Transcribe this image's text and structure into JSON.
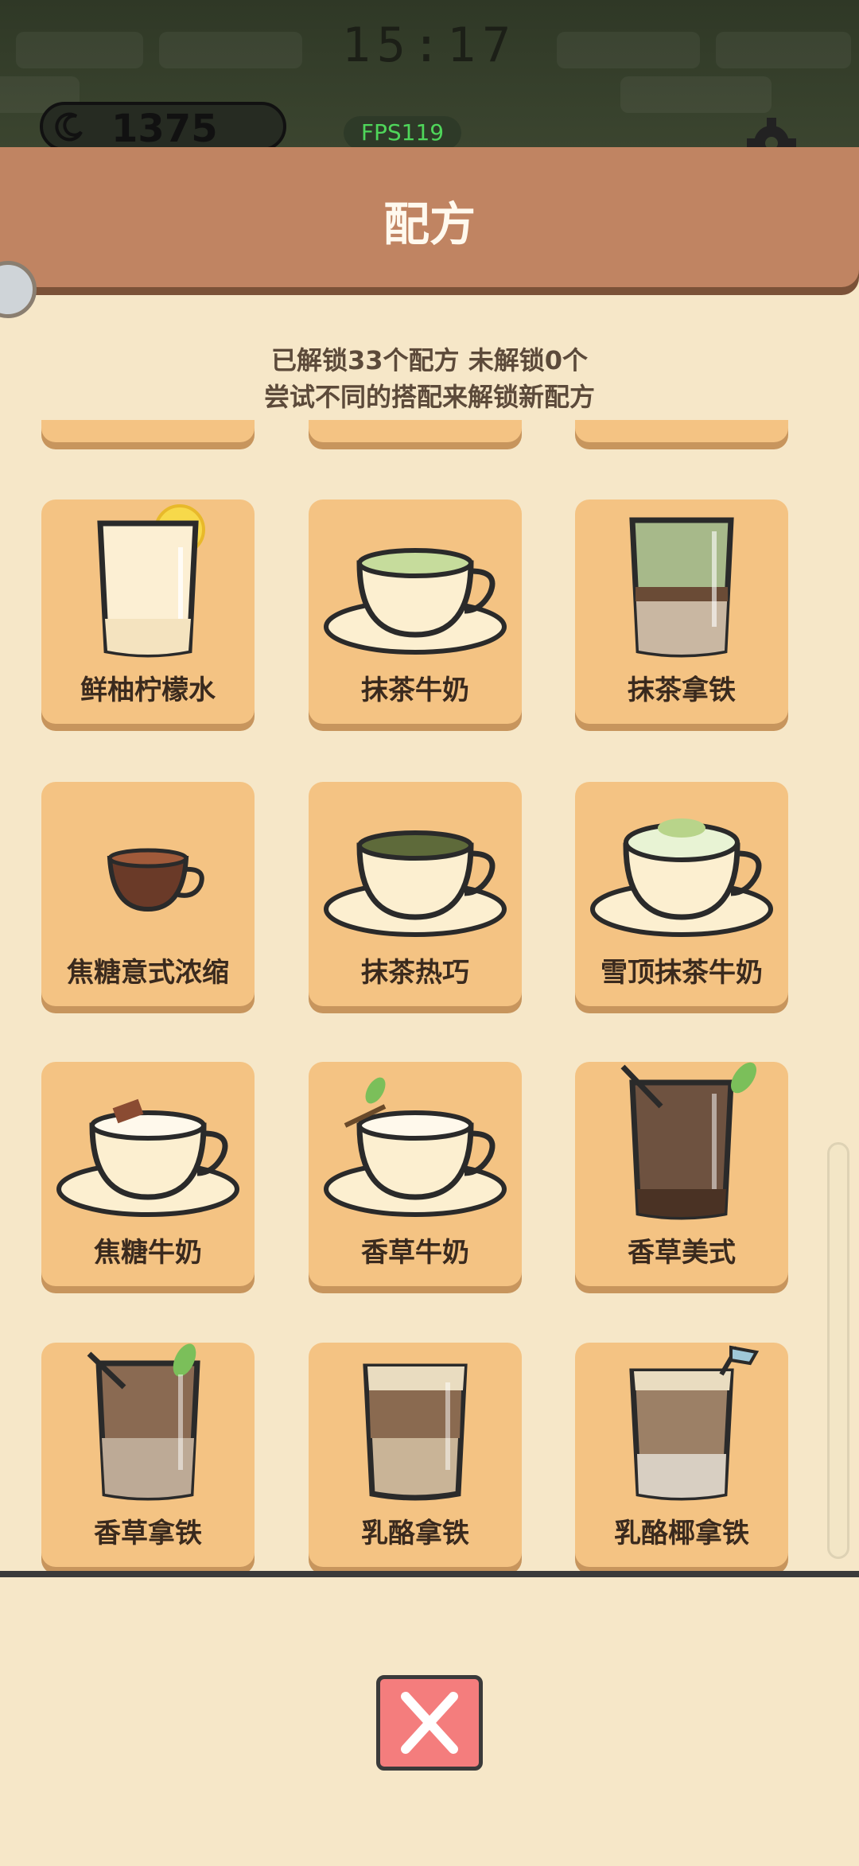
{
  "status": {
    "clock": "15:17",
    "coins": "1375",
    "fps": "FPS119"
  },
  "header": {
    "title": "配方"
  },
  "summary": {
    "line1": "已解锁33个配方 未解锁0个",
    "line2": "尝试不同的搭配来解锁新配方"
  },
  "recipes": [
    {
      "name": "鲜柚柠檬水"
    },
    {
      "name": "抹茶牛奶"
    },
    {
      "name": "抹茶拿铁"
    },
    {
      "name": "焦糖意式浓缩"
    },
    {
      "name": "抹茶热巧"
    },
    {
      "name": "雪顶抹茶牛奶"
    },
    {
      "name": "焦糖牛奶"
    },
    {
      "name": "香草牛奶"
    },
    {
      "name": "香草美式"
    },
    {
      "name": "香草拿铁"
    },
    {
      "name": "乳酪拿铁"
    },
    {
      "name": "乳酪椰拿铁"
    }
  ],
  "icons": {
    "coin": "moon-coin-icon",
    "settings": "gear-icon",
    "close": "close-x-icon"
  }
}
